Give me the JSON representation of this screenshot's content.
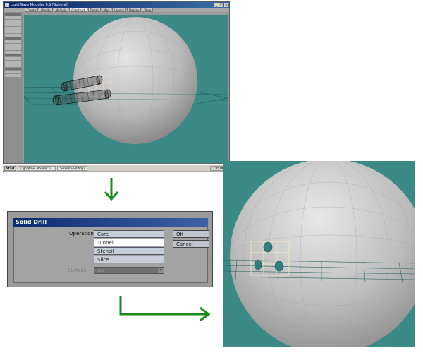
{
  "modeler": {
    "title": "LightWave Modeler 6.5 [Sphere]",
    "window_controls": [
      "_",
      "□",
      "×"
    ],
    "tabs": [
      "Create",
      "Modify",
      "Multiply",
      "Construct",
      "Detail",
      "Map",
      "Layout",
      "Display",
      "View"
    ],
    "active_tab": "Construct",
    "taskbar": {
      "start": "Start",
      "items": [
        "LightWave Modeler 6...",
        "Screen Shot.bmp"
      ],
      "tray": "2:45 PM"
    }
  },
  "dialog": {
    "title": "Solid Drill",
    "operation_label": "Operation",
    "operations": [
      "Core",
      "Tunnel",
      "Stencil",
      "Slice"
    ],
    "selected_operation": "Tunnel",
    "surface_label": "Surface",
    "surface_value": "xxx",
    "ok_label": "OK",
    "cancel_label": "Cancel"
  },
  "colors": {
    "viewport": "#3c8a86",
    "arrow": "#1a8a1a",
    "dialog_title": "#0c2a6e"
  }
}
